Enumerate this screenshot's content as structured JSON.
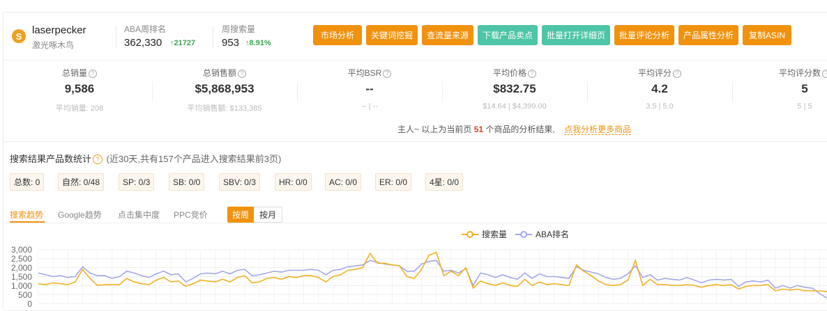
{
  "keyword": {
    "title": "laserpecker",
    "subtitle": "激光啄木鸟",
    "icon_glyph": "S",
    "icon": "brand-circle-icon"
  },
  "aba": {
    "label": "ABA周排名",
    "value": "362,330",
    "delta": "21727",
    "arrow": "↑"
  },
  "search_volume": {
    "label": "周搜索量",
    "value": "953",
    "delta": "8.91%",
    "arrow": "↑"
  },
  "buttons": [
    {
      "label": "市场分析",
      "style": "orange"
    },
    {
      "label": "关键词挖掘",
      "style": "orange"
    },
    {
      "label": "查流量来源",
      "style": "orange"
    },
    {
      "label": "下载产品卖点",
      "style": "teal"
    },
    {
      "label": "批量打开详细页",
      "style": "teal"
    },
    {
      "label": "批量评论分析",
      "style": "orange"
    },
    {
      "label": "产品属性分析",
      "style": "orange"
    },
    {
      "label": "复制ASIN",
      "style": "orange"
    }
  ],
  "stats": [
    {
      "label": "总销量",
      "value": "9,586",
      "sub": "平均销量: 208"
    },
    {
      "label": "总销售额",
      "value": "$5,868,953",
      "sub": "平均销售额: $133,385"
    },
    {
      "label": "平均BSR",
      "value": "--",
      "sub": "-- | --"
    },
    {
      "label": "平均价格",
      "value": "$832.75",
      "sub": "$14.64 | $4,399.00"
    },
    {
      "label": "平均评分",
      "value": "4.2",
      "sub": "3.5 | 5.0"
    },
    {
      "label": "平均评分数",
      "value": "5",
      "sub": "5 | 5"
    }
  ],
  "notice": {
    "prefix": "主人~ 以上为当前页",
    "count": "51",
    "suffix": "个商品的分析结果,",
    "link": "点我分析更多商品"
  },
  "search_results": {
    "title": "搜索结果产品数统计",
    "note": "(近30天,共有157个产品进入搜索结果前3页)",
    "tags": [
      "总数: 0",
      "自然: 0/48",
      "SP: 0/3",
      "SB: 0/0",
      "SBV: 0/3",
      "HR: 0/0",
      "AC: 0/0",
      "ER: 0/0",
      "4星: 0/0"
    ]
  },
  "tabs": [
    "搜索趋势",
    "Google趋势",
    "点击集中度",
    "PPC竞价"
  ],
  "period_toggle": {
    "on": "按周",
    "off": "按月"
  },
  "colors": {
    "accent": "#f0920e",
    "teal": "#4dc5a6",
    "up": "#3ca653",
    "search_series": "#f0b024",
    "aba_series": "#a3a8e8"
  },
  "chart_data": {
    "type": "line",
    "legend": [
      "搜索量",
      "ABA排名"
    ],
    "legend_position": "top-center",
    "yticks": [
      "3,000",
      "2,500",
      "2,000",
      "1,500",
      "1,000",
      "500",
      "0"
    ],
    "ylim": [
      0,
      3000
    ],
    "grid": true,
    "series": [
      {
        "name": "搜索量",
        "values": [
          1100,
          1050,
          1150,
          1100,
          1050,
          1200,
          1900,
          1400,
          1000,
          1050,
          1050,
          1050,
          1400,
          1200,
          1100,
          1050,
          1300,
          1450,
          1200,
          1250,
          950,
          1100,
          1300,
          1250,
          1200,
          1350,
          1200,
          1450,
          1550,
          1150,
          1200,
          1400,
          1450,
          1350,
          1500,
          1450,
          1550,
          1550,
          1450,
          1200,
          1500,
          1600,
          1850,
          1900,
          2000,
          2800,
          2250,
          2250,
          2150,
          2100,
          1500,
          1400,
          1900,
          2700,
          2850,
          1550,
          1800,
          1550,
          2000,
          850,
          1250,
          1100,
          1000,
          1150,
          1000,
          950,
          1350,
          1000,
          1200,
          1050,
          1100,
          1050,
          1000,
          2150,
          1800,
          1550,
          1250,
          1050,
          1000,
          1050,
          1300,
          2400,
          1000,
          1350,
          1050,
          1050,
          1000,
          1000,
          1050,
          1000,
          900,
          1000,
          1050,
          1000,
          1050,
          800,
          950,
          1000,
          1000,
          1050,
          700,
          800,
          750,
          800,
          700,
          700,
          700,
          650
        ]
      },
      {
        "name": "ABA排名",
        "values": [
          1700,
          1600,
          1500,
          1550,
          1450,
          1500,
          2050,
          1700,
          1550,
          1550,
          1400,
          1500,
          1800,
          1700,
          1550,
          1450,
          1650,
          1800,
          1600,
          1650,
          1200,
          1400,
          1650,
          1700,
          1650,
          1800,
          1650,
          1850,
          1900,
          1550,
          1600,
          1700,
          1800,
          1750,
          1850,
          1850,
          1850,
          1900,
          1850,
          1600,
          1850,
          1900,
          2050,
          2100,
          2150,
          2400,
          2300,
          2200,
          2150,
          2100,
          1800,
          1800,
          2200,
          2350,
          2400,
          1800,
          1850,
          1700,
          1950,
          1000,
          1700,
          1600,
          1450,
          1600,
          1450,
          1350,
          1700,
          1400,
          1650,
          1500,
          1500,
          1450,
          1400,
          2050,
          1850,
          1750,
          1650,
          1450,
          1350,
          1400,
          1650,
          2100,
          1450,
          1600,
          1300,
          1400,
          1350,
          1300,
          1450,
          1300,
          1150,
          1300,
          1350,
          1300,
          1350,
          950,
          1200,
          1250,
          1200,
          1300,
          850,
          1000,
          850,
          1000,
          900,
          850,
          550,
          300
        ]
      }
    ]
  }
}
